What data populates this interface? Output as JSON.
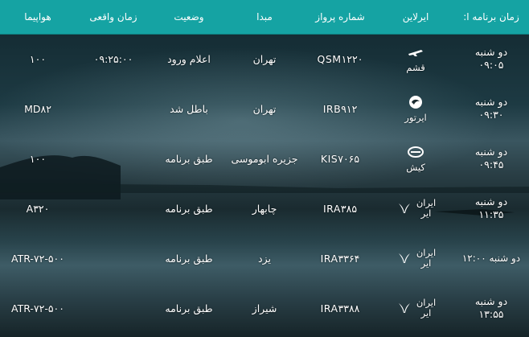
{
  "headers": {
    "scheduled_time": "زمان برنامه ا:",
    "airline": "ایرلاین",
    "flight_number": "شماره پرواز",
    "origin": "مبدا",
    "status": "وضعیت",
    "actual_time": "زمان واقعی",
    "aircraft": "هواپیما"
  },
  "flights": [
    {
      "day": "دو شنبه",
      "time": "۰۹:۰۵",
      "airline_name": "قشم",
      "airline_logo": "qeshm-air-logo",
      "flight_number": "QSM۱۲۲۰",
      "origin": "تهران",
      "status": "اعلام ورود",
      "actual_time": "۰۹:۲۵:۰۰",
      "aircraft": "۱۰۰"
    },
    {
      "day": "دو شنبه",
      "time": "۰۹:۳۰",
      "airline_name": "ایرتور",
      "airline_logo": "iran-airtour-logo",
      "flight_number": "IRB۹۱۲",
      "origin": "تهران",
      "status": "باطل شد",
      "actual_time": "",
      "aircraft": "MD۸۲"
    },
    {
      "day": "دو شنبه",
      "time": "۰۹:۴۵",
      "airline_name": "کیش",
      "airline_logo": "kish-air-logo",
      "flight_number": "KIS۷۰۶۵",
      "origin": "جزیره ابوموسی",
      "status": "طبق برنامه",
      "actual_time": "",
      "aircraft": "۱۰۰"
    },
    {
      "day": "دو شنبه",
      "time": "۱۱:۳۵",
      "airline_name_top": "ایران",
      "airline_name_bottom": "ایر",
      "airline_logo": "iran-air-logo",
      "flight_number": "IRA۳۸۵",
      "origin": "چابهار",
      "status": "طبق برنامه",
      "actual_time": "",
      "aircraft": "A۳۲۰"
    },
    {
      "day_time_inline": "دو شنبه ۱۲:۰۰",
      "airline_name_top": "ایران",
      "airline_name_bottom": "ایر",
      "airline_logo": "iran-air-logo",
      "flight_number": "IRA۳۳۶۴",
      "origin": "یزد",
      "status": "طبق برنامه",
      "actual_time": "",
      "aircraft": "ATR-۷۲-۵۰۰"
    },
    {
      "day": "دو شنبه",
      "time": "۱۳:۵۵",
      "airline_name_top": "ایران",
      "airline_name_bottom": "ایر",
      "airline_logo": "iran-air-logo",
      "flight_number": "IRA۳۳۸۸",
      "origin": "شیراز",
      "status": "طبق برنامه",
      "actual_time": "",
      "aircraft": "ATR-۷۲-۵۰۰"
    }
  ],
  "colors": {
    "header_bg": "#15a3a3",
    "text": "#ffffff"
  }
}
